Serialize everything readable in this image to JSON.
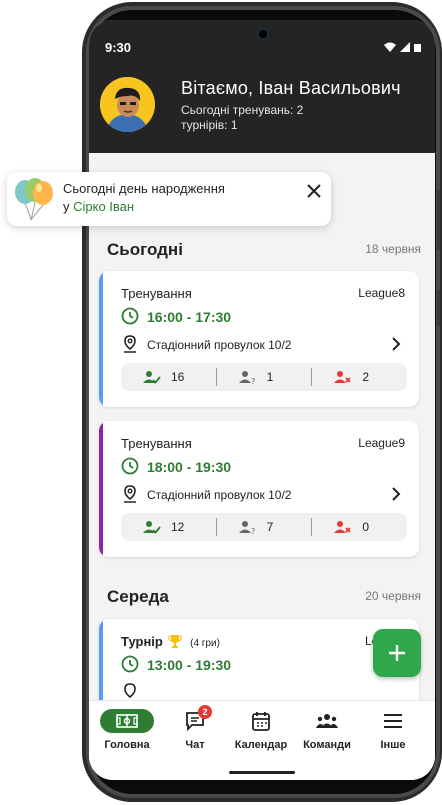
{
  "status_bar": {
    "time": "9:30"
  },
  "header": {
    "greeting": "Вітаємо, Іван Васильович",
    "trainings_today": "Сьогодні тренувань: 2",
    "tournaments": "турнірів: 1"
  },
  "toast": {
    "line1": "Сьогодні день народження",
    "prefix": "у",
    "name": "Сірко Іван",
    "icon": "balloons-icon"
  },
  "days": [
    {
      "title": "Сьогодні",
      "date": "18 червня",
      "events": [
        {
          "title": "Тренування",
          "league": "League8",
          "time": "16:00 - 17:30",
          "address": "Стадіонний провулок 10/2",
          "accent": "#5b9bf2",
          "confirmed": "16",
          "maybe": "1",
          "declined": "2"
        },
        {
          "title": "Тренування",
          "league": "League9",
          "time": "18:00 - 19:30",
          "address": "Стадіонний провулок 10/2",
          "accent": "#8e24aa",
          "confirmed": "12",
          "maybe": "7",
          "declined": "0"
        }
      ]
    },
    {
      "title": "Середа",
      "date": "20 червня",
      "events": [
        {
          "title": "Турнір",
          "games": "(4 гри)",
          "league": "League",
          "time": "13:00 - 19:30",
          "accent": "#5b9bf2"
        }
      ]
    }
  ],
  "fab": {
    "icon": "plus-icon"
  },
  "nav": [
    {
      "label": "Головна",
      "icon": "field-icon",
      "active": true
    },
    {
      "label": "Чат",
      "icon": "chat-icon",
      "badge": "2"
    },
    {
      "label": "Календар",
      "icon": "calendar-icon"
    },
    {
      "label": "Команди",
      "icon": "teams-icon"
    },
    {
      "label": "Інше",
      "icon": "menu-icon"
    }
  ],
  "colors": {
    "header_bg": "#242424",
    "accent_green": "#2e7d32",
    "fab_green": "#2ea84a",
    "decline_red": "#e53935",
    "badge_red": "#e53935"
  }
}
